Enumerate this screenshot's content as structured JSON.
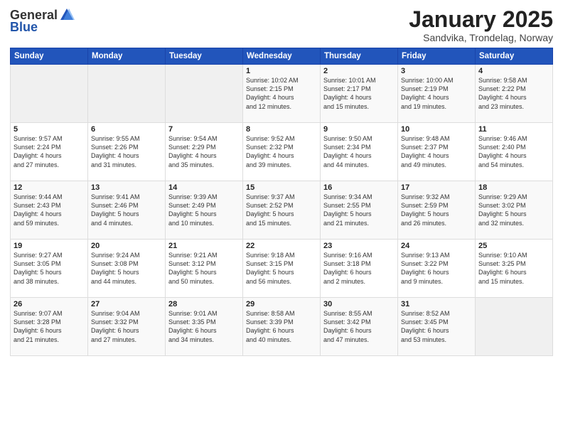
{
  "header": {
    "logo_general": "General",
    "logo_blue": "Blue",
    "title": "January 2025",
    "location": "Sandvika, Trondelag, Norway"
  },
  "weekdays": [
    "Sunday",
    "Monday",
    "Tuesday",
    "Wednesday",
    "Thursday",
    "Friday",
    "Saturday"
  ],
  "weeks": [
    [
      {
        "day": "",
        "info": ""
      },
      {
        "day": "",
        "info": ""
      },
      {
        "day": "",
        "info": ""
      },
      {
        "day": "1",
        "info": "Sunrise: 10:02 AM\nSunset: 2:15 PM\nDaylight: 4 hours\nand 12 minutes."
      },
      {
        "day": "2",
        "info": "Sunrise: 10:01 AM\nSunset: 2:17 PM\nDaylight: 4 hours\nand 15 minutes."
      },
      {
        "day": "3",
        "info": "Sunrise: 10:00 AM\nSunset: 2:19 PM\nDaylight: 4 hours\nand 19 minutes."
      },
      {
        "day": "4",
        "info": "Sunrise: 9:58 AM\nSunset: 2:22 PM\nDaylight: 4 hours\nand 23 minutes."
      }
    ],
    [
      {
        "day": "5",
        "info": "Sunrise: 9:57 AM\nSunset: 2:24 PM\nDaylight: 4 hours\nand 27 minutes."
      },
      {
        "day": "6",
        "info": "Sunrise: 9:55 AM\nSunset: 2:26 PM\nDaylight: 4 hours\nand 31 minutes."
      },
      {
        "day": "7",
        "info": "Sunrise: 9:54 AM\nSunset: 2:29 PM\nDaylight: 4 hours\nand 35 minutes."
      },
      {
        "day": "8",
        "info": "Sunrise: 9:52 AM\nSunset: 2:32 PM\nDaylight: 4 hours\nand 39 minutes."
      },
      {
        "day": "9",
        "info": "Sunrise: 9:50 AM\nSunset: 2:34 PM\nDaylight: 4 hours\nand 44 minutes."
      },
      {
        "day": "10",
        "info": "Sunrise: 9:48 AM\nSunset: 2:37 PM\nDaylight: 4 hours\nand 49 minutes."
      },
      {
        "day": "11",
        "info": "Sunrise: 9:46 AM\nSunset: 2:40 PM\nDaylight: 4 hours\nand 54 minutes."
      }
    ],
    [
      {
        "day": "12",
        "info": "Sunrise: 9:44 AM\nSunset: 2:43 PM\nDaylight: 4 hours\nand 59 minutes."
      },
      {
        "day": "13",
        "info": "Sunrise: 9:41 AM\nSunset: 2:46 PM\nDaylight: 5 hours\nand 4 minutes."
      },
      {
        "day": "14",
        "info": "Sunrise: 9:39 AM\nSunset: 2:49 PM\nDaylight: 5 hours\nand 10 minutes."
      },
      {
        "day": "15",
        "info": "Sunrise: 9:37 AM\nSunset: 2:52 PM\nDaylight: 5 hours\nand 15 minutes."
      },
      {
        "day": "16",
        "info": "Sunrise: 9:34 AM\nSunset: 2:55 PM\nDaylight: 5 hours\nand 21 minutes."
      },
      {
        "day": "17",
        "info": "Sunrise: 9:32 AM\nSunset: 2:59 PM\nDaylight: 5 hours\nand 26 minutes."
      },
      {
        "day": "18",
        "info": "Sunrise: 9:29 AM\nSunset: 3:02 PM\nDaylight: 5 hours\nand 32 minutes."
      }
    ],
    [
      {
        "day": "19",
        "info": "Sunrise: 9:27 AM\nSunset: 3:05 PM\nDaylight: 5 hours\nand 38 minutes."
      },
      {
        "day": "20",
        "info": "Sunrise: 9:24 AM\nSunset: 3:08 PM\nDaylight: 5 hours\nand 44 minutes."
      },
      {
        "day": "21",
        "info": "Sunrise: 9:21 AM\nSunset: 3:12 PM\nDaylight: 5 hours\nand 50 minutes."
      },
      {
        "day": "22",
        "info": "Sunrise: 9:18 AM\nSunset: 3:15 PM\nDaylight: 5 hours\nand 56 minutes."
      },
      {
        "day": "23",
        "info": "Sunrise: 9:16 AM\nSunset: 3:18 PM\nDaylight: 6 hours\nand 2 minutes."
      },
      {
        "day": "24",
        "info": "Sunrise: 9:13 AM\nSunset: 3:22 PM\nDaylight: 6 hours\nand 9 minutes."
      },
      {
        "day": "25",
        "info": "Sunrise: 9:10 AM\nSunset: 3:25 PM\nDaylight: 6 hours\nand 15 minutes."
      }
    ],
    [
      {
        "day": "26",
        "info": "Sunrise: 9:07 AM\nSunset: 3:28 PM\nDaylight: 6 hours\nand 21 minutes."
      },
      {
        "day": "27",
        "info": "Sunrise: 9:04 AM\nSunset: 3:32 PM\nDaylight: 6 hours\nand 27 minutes."
      },
      {
        "day": "28",
        "info": "Sunrise: 9:01 AM\nSunset: 3:35 PM\nDaylight: 6 hours\nand 34 minutes."
      },
      {
        "day": "29",
        "info": "Sunrise: 8:58 AM\nSunset: 3:39 PM\nDaylight: 6 hours\nand 40 minutes."
      },
      {
        "day": "30",
        "info": "Sunrise: 8:55 AM\nSunset: 3:42 PM\nDaylight: 6 hours\nand 47 minutes."
      },
      {
        "day": "31",
        "info": "Sunrise: 8:52 AM\nSunset: 3:45 PM\nDaylight: 6 hours\nand 53 minutes."
      },
      {
        "day": "",
        "info": ""
      }
    ]
  ]
}
